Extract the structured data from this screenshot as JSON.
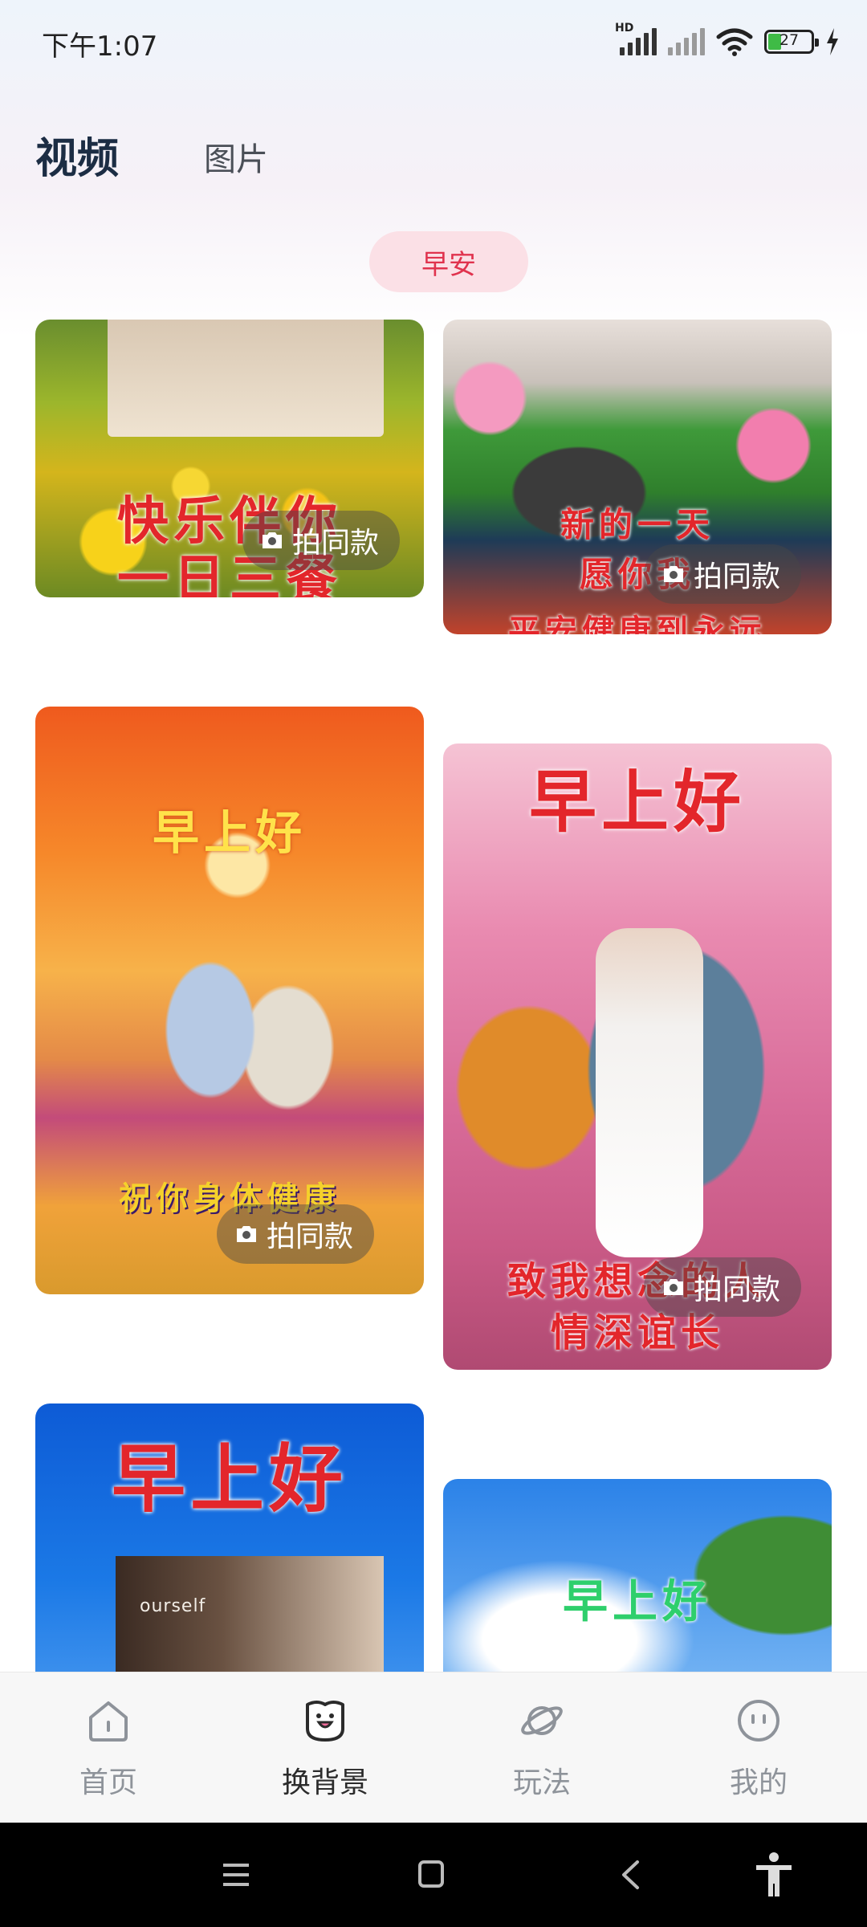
{
  "status_bar": {
    "time": "下午1:07",
    "network_label": "HD",
    "battery_level": "27",
    "icons": [
      "signal-icon",
      "signal-off-icon",
      "wifi-icon",
      "battery-icon",
      "charging-icon"
    ]
  },
  "tabs": {
    "video": "视频",
    "image": "图片",
    "active": "video"
  },
  "category_chip": "早安",
  "cards": [
    {
      "overlay": [
        "快乐伴你",
        "一日三餐"
      ],
      "button": "拍同款"
    },
    {
      "overlay": [
        "新的一天",
        "愿你我",
        "平安健康到永远"
      ],
      "button": "拍同款"
    },
    {
      "overlay": [
        "早上好",
        "祝你身体健康"
      ],
      "button": "拍同款"
    },
    {
      "overlay": [
        "早上好",
        "致我想念的人",
        "情深谊长"
      ],
      "button": "拍同款"
    },
    {
      "overlay": [
        "早上好",
        "ourself"
      ],
      "button": ""
    },
    {
      "overlay": [
        "早上好"
      ],
      "button": ""
    }
  ],
  "bottom_nav": {
    "items": [
      {
        "label": "首页",
        "icon": "home-icon"
      },
      {
        "label": "换背景",
        "icon": "swap-background-icon"
      },
      {
        "label": "玩法",
        "icon": "planet-icon"
      },
      {
        "label": "我的",
        "icon": "profile-face-icon"
      }
    ],
    "active": "换背景"
  },
  "system_nav": [
    "menu-icon",
    "home-square-icon",
    "back-icon",
    "accessibility-icon"
  ],
  "colors": {
    "accent": "#e0334e",
    "chip_bg": "#fbe0e6",
    "tab_active": "#1c2d44"
  }
}
